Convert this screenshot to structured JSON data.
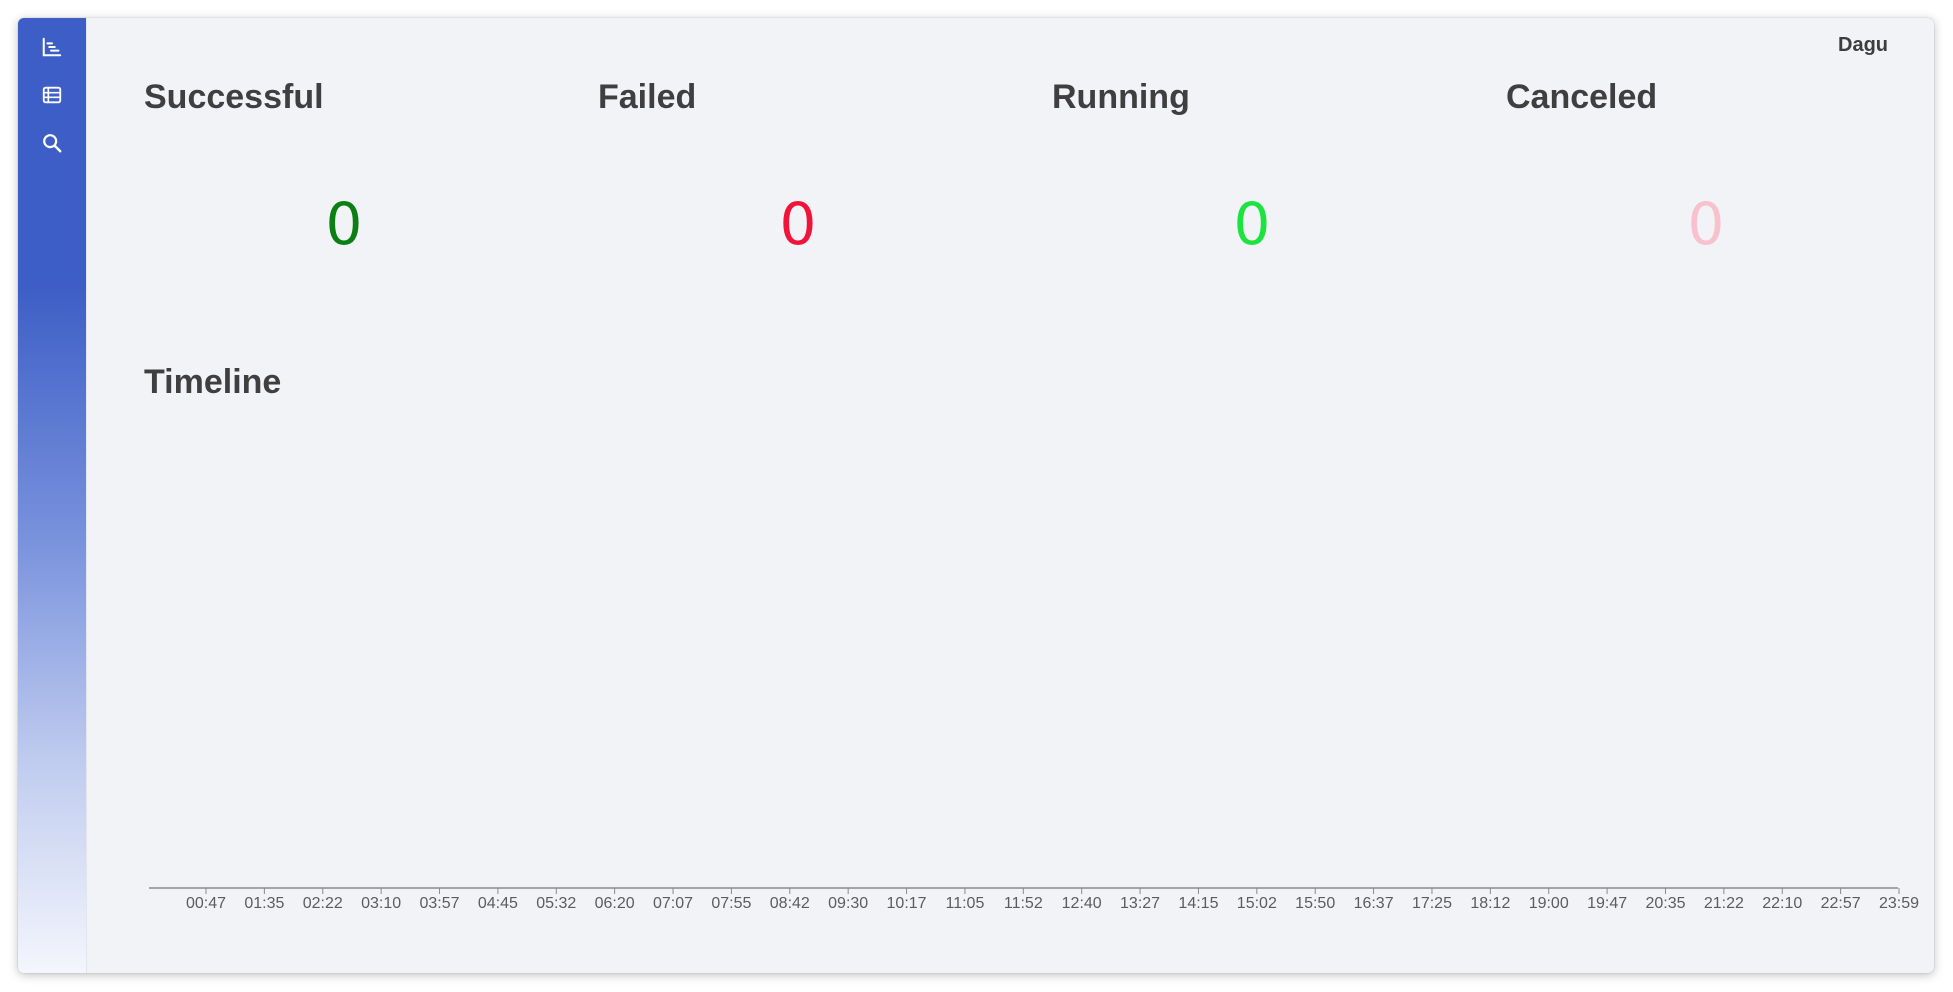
{
  "app": {
    "brand": "Dagu"
  },
  "sidebar": {
    "items": [
      {
        "name": "dashboard",
        "icon": "chart-icon"
      },
      {
        "name": "dags",
        "icon": "table-list-icon"
      },
      {
        "name": "search",
        "icon": "search-icon"
      }
    ]
  },
  "stats": [
    {
      "label": "Successful",
      "value": "0",
      "color": "#0b7f14"
    },
    {
      "label": "Failed",
      "value": "0",
      "color": "#f0143a"
    },
    {
      "label": "Running",
      "value": "0",
      "color": "#1de340"
    },
    {
      "label": "Canceled",
      "value": "0",
      "color": "#f7c1cd"
    }
  ],
  "timeline": {
    "title": "Timeline",
    "ticks": [
      "00:47",
      "01:35",
      "02:22",
      "03:10",
      "03:57",
      "04:45",
      "05:32",
      "06:20",
      "07:07",
      "07:55",
      "08:42",
      "09:30",
      "10:17",
      "11:05",
      "11:52",
      "12:40",
      "13:27",
      "14:15",
      "15:02",
      "15:50",
      "16:37",
      "17:25",
      "18:12",
      "19:00",
      "19:47",
      "20:35",
      "21:22",
      "22:10",
      "22:57",
      "23:59"
    ]
  }
}
